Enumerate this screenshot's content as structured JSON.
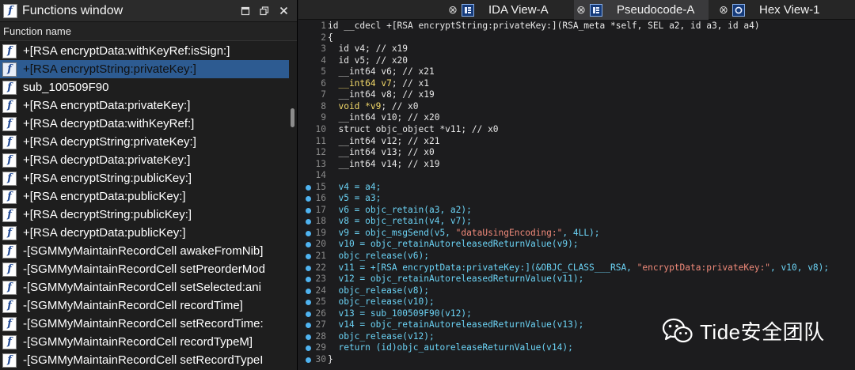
{
  "functions_window": {
    "title": "Functions window",
    "column_header": "Function name",
    "selected_index": 1,
    "items": [
      "+[RSA encryptData:withKeyRef:isSign:]",
      "+[RSA encryptString:privateKey:]",
      "sub_100509F90",
      "+[RSA encryptData:privateKey:]",
      "+[RSA decryptData:withKeyRef:]",
      "+[RSA decryptString:privateKey:]",
      "+[RSA decryptData:privateKey:]",
      "+[RSA encryptString:publicKey:]",
      "+[RSA encryptData:publicKey:]",
      "+[RSA decryptString:publicKey:]",
      "+[RSA decryptData:publicKey:]",
      "-[SGMMyMaintainRecordCell awakeFromNib]",
      "-[SGMMyMaintainRecordCell setPreorderMod",
      "-[SGMMyMaintainRecordCell setSelected:ani",
      "-[SGMMyMaintainRecordCell recordTime]",
      "-[SGMMyMaintainRecordCell setRecordTime:",
      "-[SGMMyMaintainRecordCell recordTypeM]",
      "-[SGMMyMaintainRecordCell setRecordTypeI"
    ]
  },
  "tabs": [
    {
      "label": "IDA View-A",
      "active": false
    },
    {
      "label": "Pseudocode-A",
      "active": true
    },
    {
      "label": "Hex View-1",
      "active": false
    }
  ],
  "code_lines": [
    {
      "n": "1",
      "dot": false,
      "parts": [
        [
          "t",
          "id __cdecl +[RSA encryptString:privateKey:](RSA_meta *self, SEL a2, id a3, id a4)"
        ]
      ]
    },
    {
      "n": "2",
      "dot": false,
      "parts": [
        [
          "t",
          "{"
        ]
      ]
    },
    {
      "n": "3",
      "dot": false,
      "parts": [
        [
          "t",
          "  id v4; // x19"
        ]
      ]
    },
    {
      "n": "4",
      "dot": false,
      "parts": [
        [
          "t",
          "  id v5; // x20"
        ]
      ]
    },
    {
      "n": "5",
      "dot": false,
      "parts": [
        [
          "t",
          "  __int64 v6; // x21"
        ]
      ]
    },
    {
      "n": "6",
      "dot": false,
      "parts": [
        [
          "y",
          "  __int64 v7"
        ],
        [
          "t",
          "; // x1"
        ]
      ]
    },
    {
      "n": "7",
      "dot": false,
      "parts": [
        [
          "t",
          "  __int64 v8; // x19"
        ]
      ]
    },
    {
      "n": "8",
      "dot": false,
      "parts": [
        [
          "y",
          "  void *v9"
        ],
        [
          "t",
          "; // x0"
        ]
      ]
    },
    {
      "n": "9",
      "dot": false,
      "parts": [
        [
          "t",
          "  __int64 v10; // x20"
        ]
      ]
    },
    {
      "n": "10",
      "dot": false,
      "parts": [
        [
          "t",
          "  struct objc_object *v11; // x0"
        ]
      ]
    },
    {
      "n": "11",
      "dot": false,
      "parts": [
        [
          "t",
          "  __int64 v12; // x21"
        ]
      ]
    },
    {
      "n": "12",
      "dot": false,
      "parts": [
        [
          "t",
          "  __int64 v13; // x0"
        ]
      ]
    },
    {
      "n": "13",
      "dot": false,
      "parts": [
        [
          "t",
          "  __int64 v14; // x19"
        ]
      ]
    },
    {
      "n": "14",
      "dot": false,
      "parts": [
        [
          "t",
          ""
        ]
      ]
    },
    {
      "n": "15",
      "dot": true,
      "parts": [
        [
          "c",
          "  v4 = a4;"
        ]
      ]
    },
    {
      "n": "16",
      "dot": true,
      "parts": [
        [
          "c",
          "  v5 = a3;"
        ]
      ]
    },
    {
      "n": "17",
      "dot": true,
      "parts": [
        [
          "c",
          "  v6 = objc_retain(a3, a2);"
        ]
      ]
    },
    {
      "n": "18",
      "dot": true,
      "parts": [
        [
          "c",
          "  v8 = objc_retain(v4, v7);"
        ]
      ]
    },
    {
      "n": "19",
      "dot": true,
      "parts": [
        [
          "c",
          "  v9 = objc_msgSend(v5, "
        ],
        [
          "s",
          "\"dataUsingEncoding:\""
        ],
        [
          "c",
          ", 4LL);"
        ]
      ]
    },
    {
      "n": "20",
      "dot": true,
      "parts": [
        [
          "c",
          "  v10 = objc_retainAutoreleasedReturnValue(v9);"
        ]
      ]
    },
    {
      "n": "21",
      "dot": true,
      "parts": [
        [
          "c",
          "  objc_release(v6);"
        ]
      ]
    },
    {
      "n": "22",
      "dot": true,
      "parts": [
        [
          "c",
          "  v11 = +[RSA encryptData:privateKey:](&OBJC_CLASS___RSA, "
        ],
        [
          "s",
          "\"encryptData:privateKey:\""
        ],
        [
          "c",
          ", v10, v8);"
        ]
      ]
    },
    {
      "n": "23",
      "dot": true,
      "parts": [
        [
          "c",
          "  v12 = objc_retainAutoreleasedReturnValue(v11);"
        ]
      ]
    },
    {
      "n": "24",
      "dot": true,
      "parts": [
        [
          "c",
          "  objc_release(v8);"
        ]
      ]
    },
    {
      "n": "25",
      "dot": true,
      "parts": [
        [
          "c",
          "  objc_release(v10);"
        ]
      ]
    },
    {
      "n": "26",
      "dot": true,
      "parts": [
        [
          "c",
          "  v13 = sub_100509F90(v12);"
        ]
      ]
    },
    {
      "n": "27",
      "dot": true,
      "parts": [
        [
          "c",
          "  v14 = objc_retainAutoreleasedReturnValue(v13);"
        ]
      ]
    },
    {
      "n": "28",
      "dot": true,
      "parts": [
        [
          "c",
          "  objc_release(v12);"
        ]
      ]
    },
    {
      "n": "29",
      "dot": true,
      "parts": [
        [
          "c",
          "  return (id)objc_autoreleaseReturnValue(v14);"
        ]
      ]
    },
    {
      "n": "30",
      "dot": true,
      "parts": [
        [
          "t",
          "}"
        ]
      ]
    }
  ],
  "watermark": {
    "text": "Tide安全团队"
  },
  "colors": {
    "selection": "#2d5b91",
    "accent_dot": "#4fb3f0",
    "string": "#f08a7a",
    "code_cyan": "#6bd3f5",
    "var_yellow": "#f3d96a"
  }
}
